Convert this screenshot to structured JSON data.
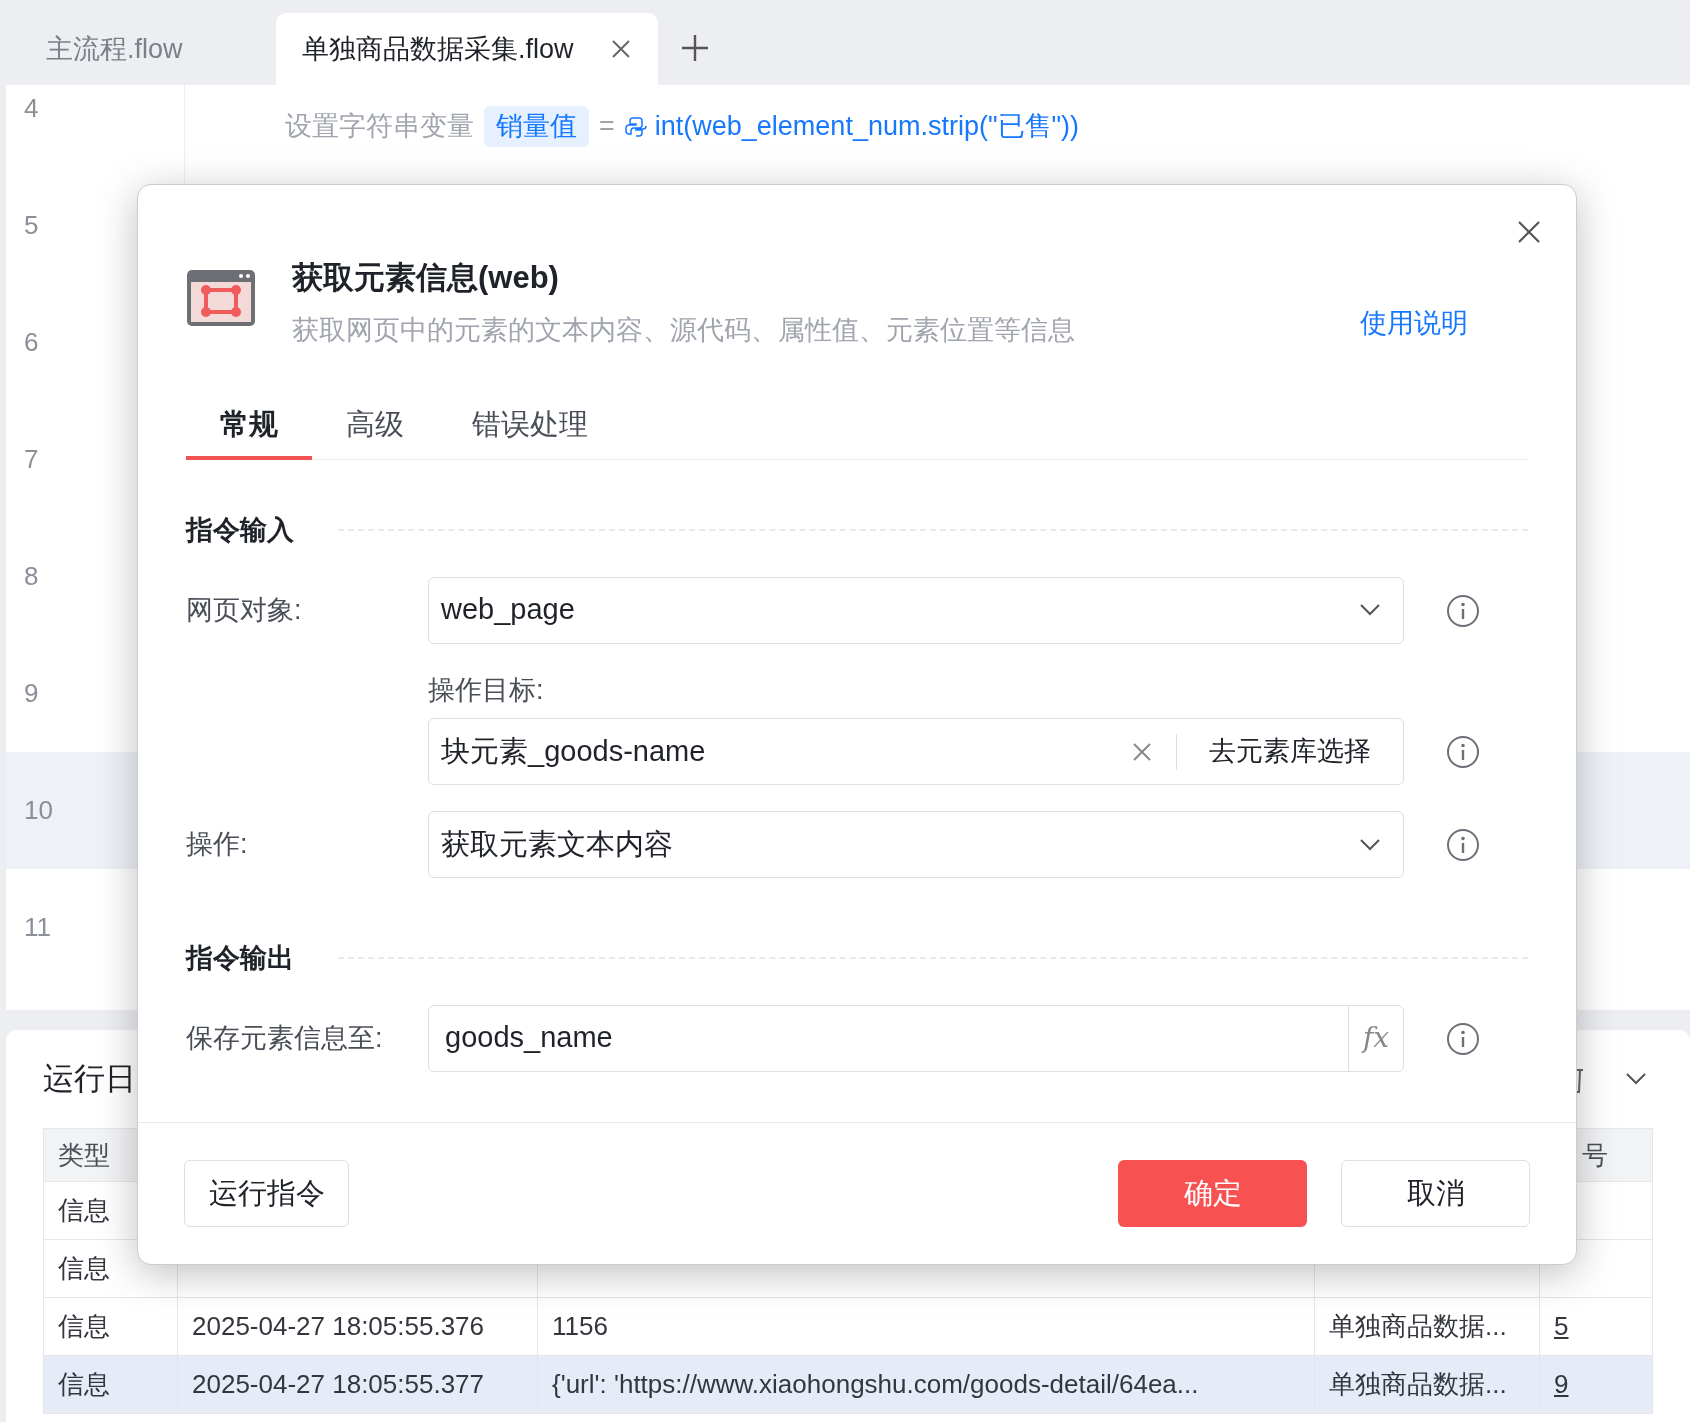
{
  "tabs": [
    {
      "label": "主流程.flow",
      "selected": false
    },
    {
      "label": "单独商品数据采集.flow",
      "selected": true
    }
  ],
  "editor": {
    "lines": [
      {
        "number": "4",
        "selected": false,
        "keyword": "设置字符串变量",
        "variable": "销量值",
        "operator": "=",
        "expression": "int(web_element_num.strip(\"已售\"))"
      },
      {
        "number": "5",
        "selected": false
      },
      {
        "number": "6",
        "selected": false
      },
      {
        "number": "7",
        "selected": false
      },
      {
        "number": "8",
        "selected": false
      },
      {
        "number": "9",
        "selected": false
      },
      {
        "number": "10",
        "selected": true
      },
      {
        "number": "11",
        "selected": false
      }
    ]
  },
  "log_panel": {
    "title": "运行日",
    "column_headers": {
      "column_1": "类型",
      "column_5": "号"
    },
    "rows": [
      {
        "selected": false,
        "cells": [
          "信息"
        ]
      },
      {
        "selected": false,
        "cells": [
          "信息"
        ]
      },
      {
        "selected": false,
        "cells": [
          "信息",
          "2025-04-27 18:05:55.376",
          "1156",
          "单独商品数据...",
          "5"
        ]
      },
      {
        "selected": true,
        "cells": [
          "信息",
          "2025-04-27 18:05:55.377",
          "{'url': 'https://www.xiaohongshu.com/goods-detail/64ea...",
          "单独商品数据...",
          "9"
        ]
      }
    ]
  },
  "dialog": {
    "title": "获取元素信息(web)",
    "description": "获取网页中的元素的文本内容、源代码、属性值、元素位置等信息",
    "help_link": "使用说明",
    "tabs": [
      {
        "label": "常规",
        "selected": true
      },
      {
        "label": "高级",
        "selected": false
      },
      {
        "label": "错误处理",
        "selected": false
      }
    ],
    "sections": [
      {
        "title": "指令输入",
        "fields": [
          {
            "kind": "select",
            "label": "网页对象:",
            "value": "web_page"
          },
          {
            "kind": "picker",
            "label": "操作目标:",
            "value": "块元素_goods-name",
            "button": "去元素库选择"
          },
          {
            "kind": "select",
            "label": "操作:",
            "value": "获取元素文本内容"
          }
        ]
      },
      {
        "title": "指令输出",
        "fields": [
          {
            "kind": "variable",
            "label": "保存元素信息至:",
            "value": "goods_name",
            "button": "fx"
          }
        ]
      }
    ],
    "buttons": [
      {
        "label": "运行指令",
        "kind": "secondary"
      },
      {
        "label": "确定",
        "kind": "primary"
      },
      {
        "label": "取消",
        "kind": "secondary"
      }
    ]
  }
}
